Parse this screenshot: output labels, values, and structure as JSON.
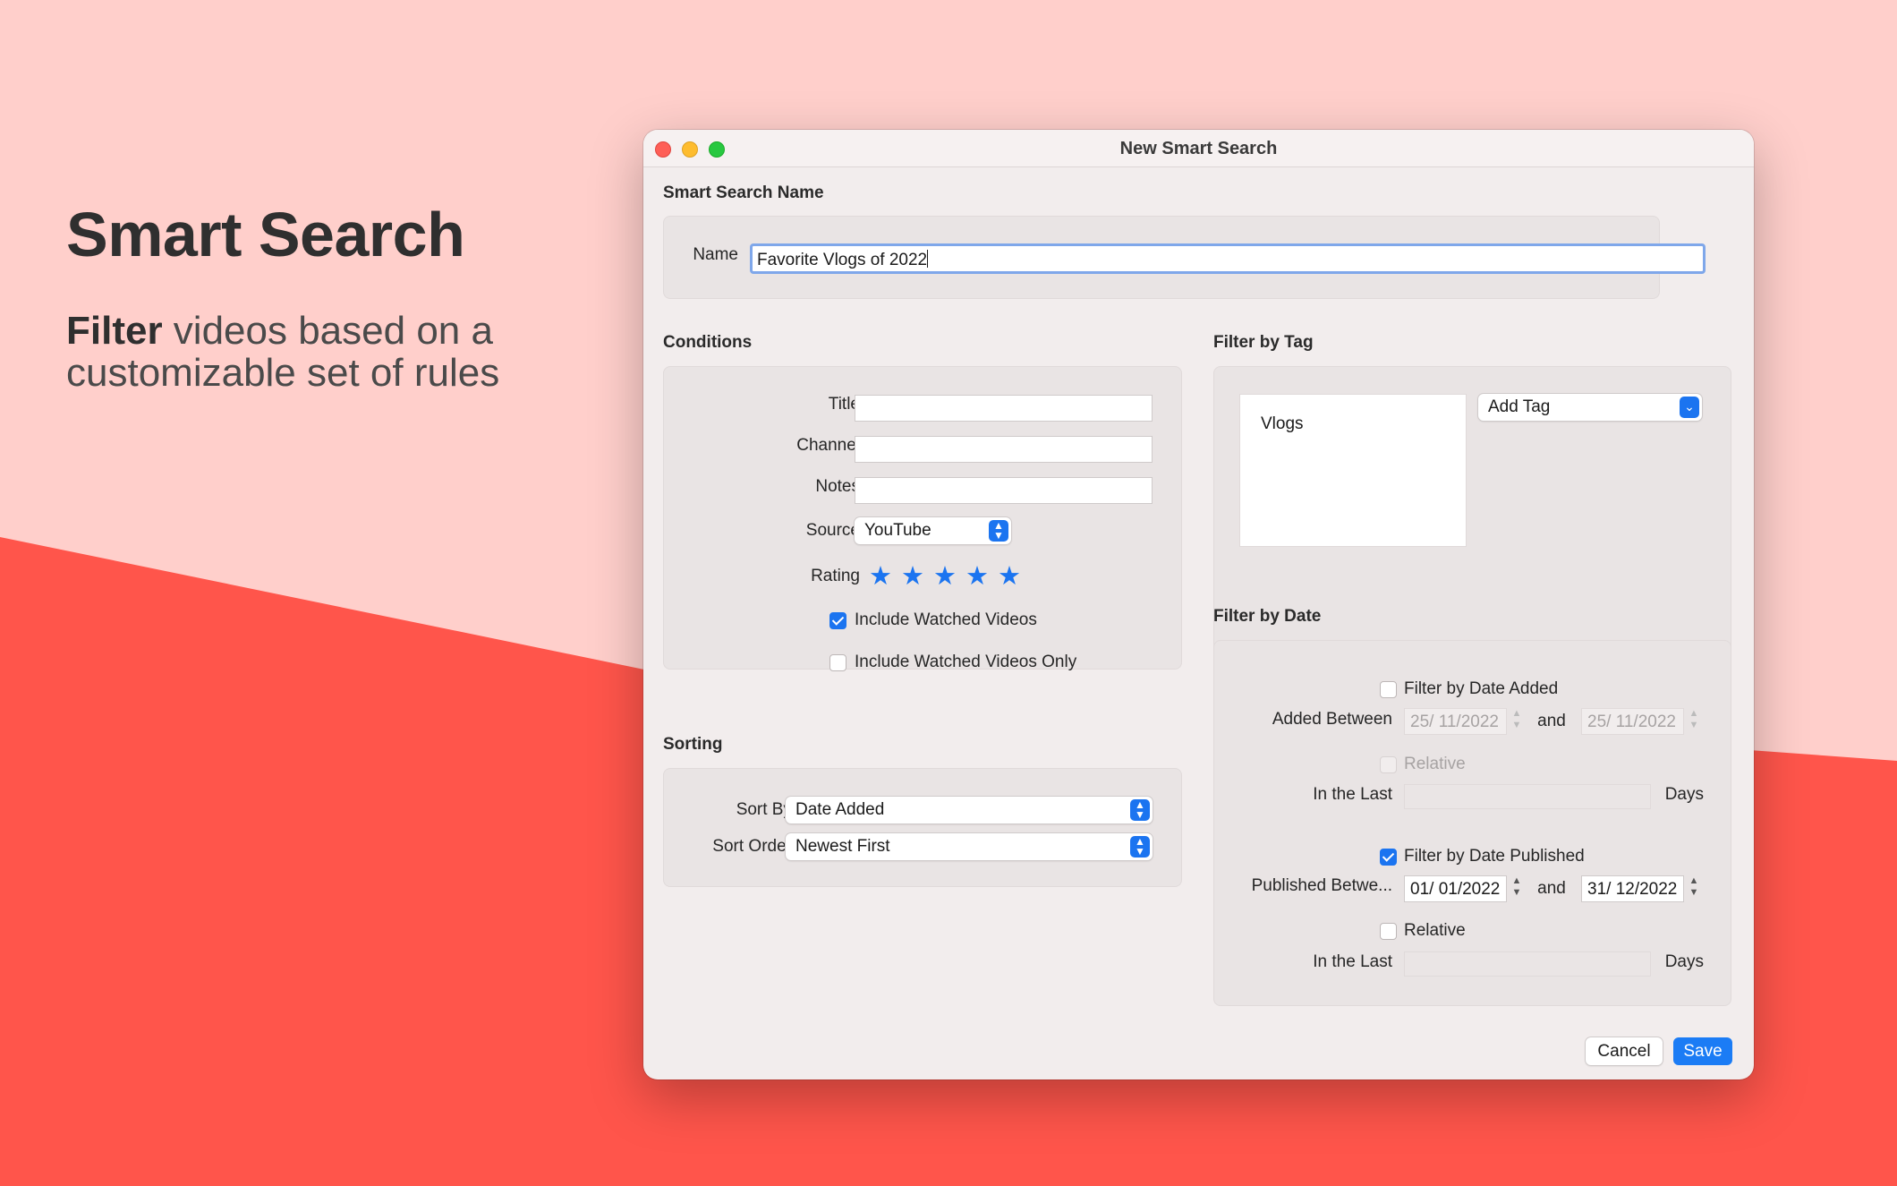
{
  "hero": {
    "title": "Smart Search",
    "subtitle_bold": "Filter",
    "subtitle_rest": " videos based on a customizable set of rules"
  },
  "window": {
    "title": "New Smart Search"
  },
  "name_section": {
    "label": "Smart Search Name",
    "field_label": "Name",
    "value": "Favorite Vlogs of 2022"
  },
  "conditions": {
    "label": "Conditions",
    "title_label": "Title",
    "title_value": "",
    "channel_label": "Channel",
    "channel_value": "",
    "notes_label": "Notes",
    "notes_value": "",
    "source_label": "Source",
    "source_value": "YouTube",
    "rating_label": "Rating",
    "rating_stars": 5,
    "include_watched_label": "Include Watched Videos",
    "include_watched_checked": true,
    "include_watched_only_label": "Include Watched Videos Only",
    "include_watched_only_checked": false
  },
  "sorting": {
    "label": "Sorting",
    "sort_by_label": "Sort By",
    "sort_by_value": "Date Added",
    "sort_order_label": "Sort Order",
    "sort_order_value": "Newest First"
  },
  "filter_by_tag": {
    "label": "Filter by Tag",
    "tags": [
      "Vlogs"
    ],
    "add_tag_label": "Add Tag"
  },
  "filter_by_date": {
    "label": "Filter by Date",
    "added": {
      "checkbox_label": "Filter by Date Added",
      "checked": false,
      "between_label": "Added Between",
      "start": "25/ 11/2022",
      "and_label": "and",
      "end": "25/ 11/2022",
      "relative_label": "Relative",
      "relative_checked": false,
      "in_the_last_label": "In the Last",
      "days_value": "",
      "days_label": "Days"
    },
    "published": {
      "checkbox_label": "Filter by Date Published",
      "checked": true,
      "between_label": "Published Betwe...",
      "start": "01/ 01/2022",
      "and_label": "and",
      "end": "31/ 12/2022",
      "relative_label": "Relative",
      "relative_checked": false,
      "in_the_last_label": "In the Last",
      "days_value": "",
      "days_label": "Days"
    }
  },
  "buttons": {
    "cancel": "Cancel",
    "save": "Save"
  },
  "colors": {
    "accent": "#1b74f0",
    "background_top": "#ffcfcb",
    "background_bottom": "#ff554b"
  }
}
